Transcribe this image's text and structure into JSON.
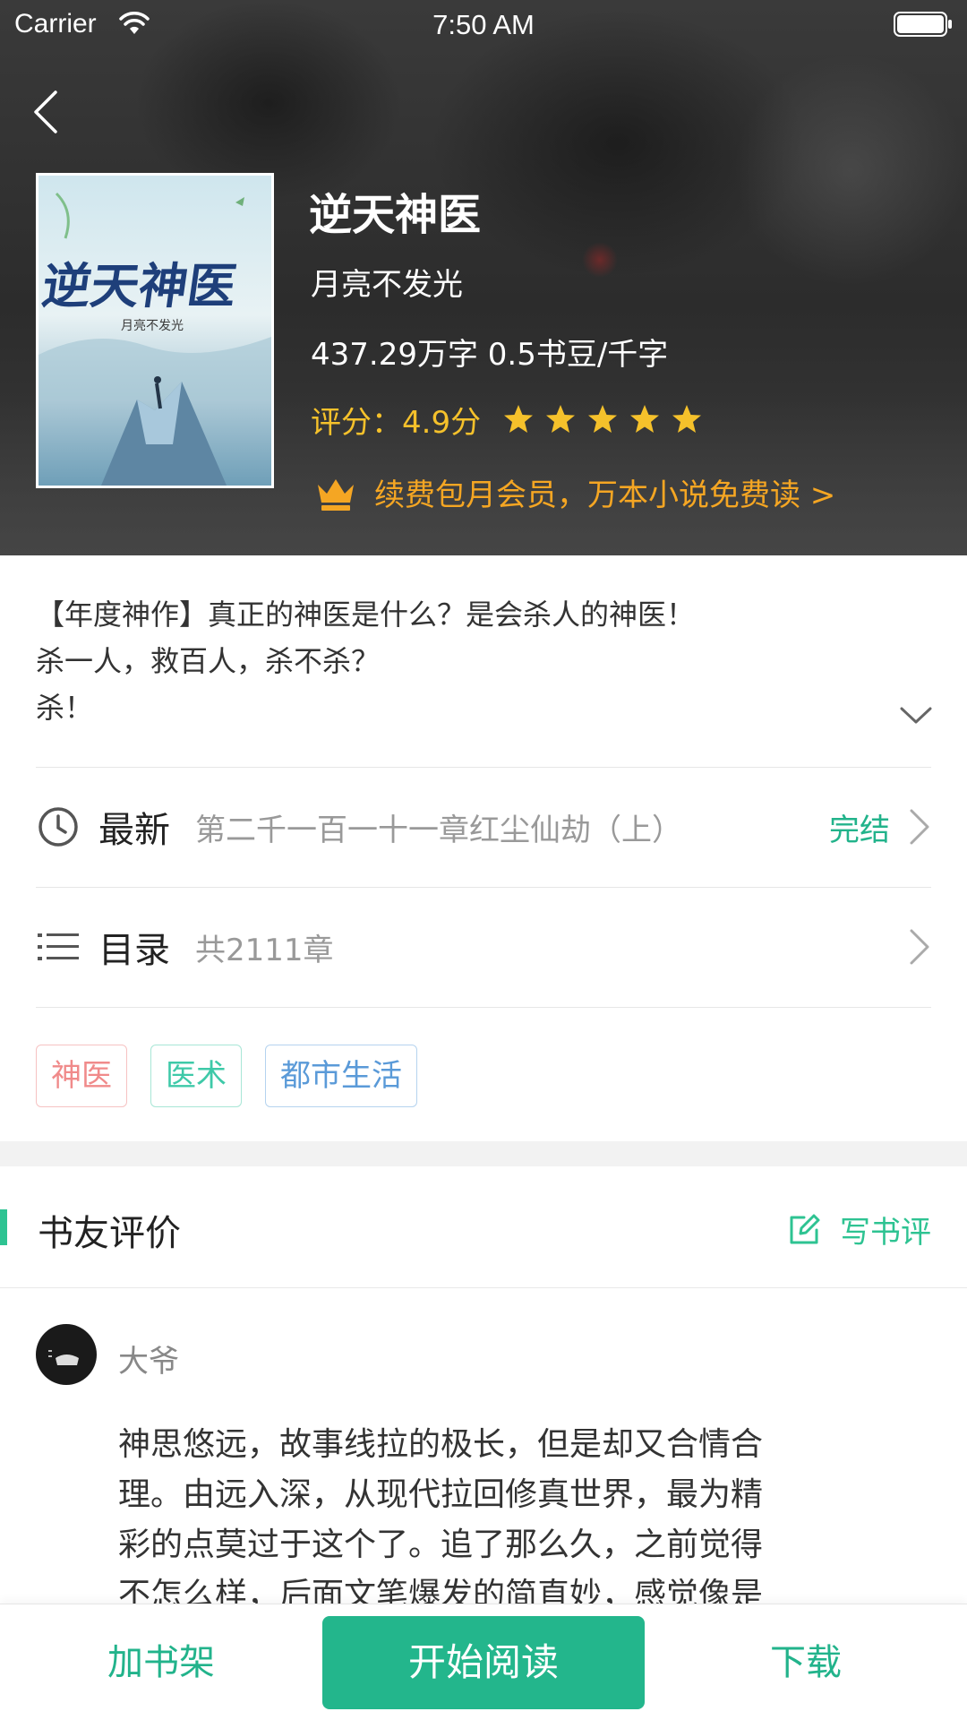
{
  "status_bar": {
    "carrier": "Carrier",
    "time": "7:50 AM"
  },
  "book": {
    "title": "逆天神医",
    "author": "月亮不发光",
    "stats": "437.29万字 0.5书豆/千字",
    "rating_text": "评分：4.9分",
    "rating": 4.9,
    "stars": 5,
    "vip_text": "续费包月会员，万本小说免费读 >",
    "cover": {
      "title": "逆天神医",
      "author": "月亮不发光"
    }
  },
  "synopsis": [
    "【年度神作】真正的神医是什么？是会杀人的神医！",
    "杀一人，救百人，杀不杀？",
    "杀！"
  ],
  "latest": {
    "label": "最新",
    "chapter": "第二千一百一十一章红尘仙劫（上）",
    "status": "完结"
  },
  "catalog": {
    "label": "目录",
    "count": "共2111章"
  },
  "tags": [
    "神医",
    "医术",
    "都市生活"
  ],
  "reviews": {
    "title": "书友评价",
    "write_label": "写书评",
    "items": [
      {
        "name": "大爷",
        "lines": [
          "神思悠远，故事线拉的极长，但是却又合情合",
          "理。由远入深，从现代拉回修真世界，最为精",
          "彩的点莫过于这个了。追了那么久，之前觉得",
          "不怎么样，后面文笔爆发的简直妙，感觉像是"
        ]
      }
    ]
  },
  "actions": {
    "add_shelf": "加书架",
    "start_reading": "开始阅读",
    "download": "下载"
  },
  "colors": {
    "accent": "#23b68c",
    "rating": "#f5c12b",
    "vip": "#f5a623"
  }
}
